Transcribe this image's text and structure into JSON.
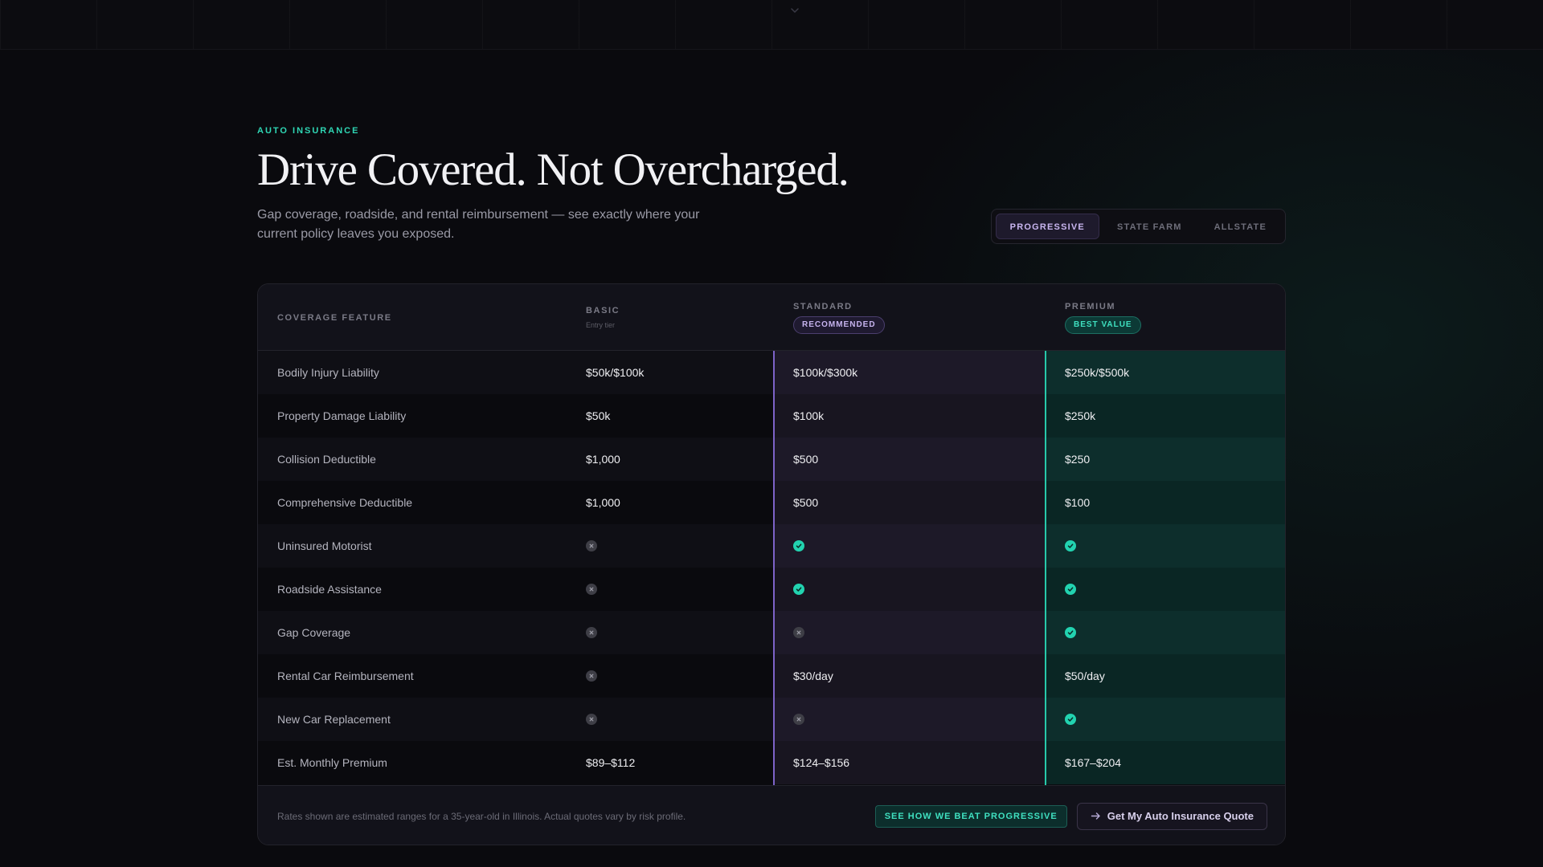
{
  "hero": {
    "eyebrow": "AUTO INSURANCE",
    "title": "Drive Covered. Not Overcharged.",
    "subtitle": "Gap coverage, roadside, and rental reimbursement — see exactly where your current policy leaves you exposed."
  },
  "carriers": {
    "tabs": [
      "PROGRESSIVE",
      "STATE FARM",
      "ALLSTATE"
    ],
    "active": "PROGRESSIVE"
  },
  "table": {
    "header": {
      "feature": "COVERAGE FEATURE",
      "basic": "BASIC",
      "basic_sub": "Entry tier",
      "standard": "STANDARD",
      "standard_badge": "RECOMMENDED",
      "premium": "PREMIUM",
      "premium_badge": "BEST VALUE"
    },
    "rows": [
      {
        "feature": "Bodily Injury Liability",
        "basic": "$50k/$100k",
        "standard": "$100k/$300k",
        "premium": "$250k/$500k"
      },
      {
        "feature": "Property Damage Liability",
        "basic": "$50k",
        "standard": "$100k",
        "premium": "$250k"
      },
      {
        "feature": "Collision Deductible",
        "basic": "$1,000",
        "standard": "$500",
        "premium": "$250"
      },
      {
        "feature": "Comprehensive Deductible",
        "basic": "$1,000",
        "standard": "$500",
        "premium": "$100"
      },
      {
        "feature": "Uninsured Motorist",
        "basic": "no",
        "standard": "yes",
        "premium": "yes"
      },
      {
        "feature": "Roadside Assistance",
        "basic": "no",
        "standard": "yes",
        "premium": "yes"
      },
      {
        "feature": "Gap Coverage",
        "basic": "no",
        "standard": "no",
        "premium": "yes"
      },
      {
        "feature": "Rental Car Reimbursement",
        "basic": "no",
        "standard": "$30/day",
        "premium": "$50/day"
      },
      {
        "feature": "New Car Replacement",
        "basic": "no",
        "standard": "no",
        "premium": "yes"
      },
      {
        "feature": "Est. Monthly Premium",
        "basic": "$89–$112",
        "standard": "$124–$156",
        "premium": "$167–$204"
      }
    ],
    "footer": {
      "disclaimer": "Rates shown are estimated ranges for a 35-year-old in Illinois. Actual quotes vary by risk profile.",
      "beat_label": "SEE HOW WE BEAT PROGRESSIVE",
      "quote_label": "Get My Auto Insurance Quote"
    }
  },
  "colors": {
    "accent_teal": "#2fd6b4",
    "accent_purple": "#7d63c8",
    "background": "#0a0a0e"
  },
  "icons": {
    "included": "check-circle-icon",
    "excluded": "x-circle-icon",
    "scroll": "chevron-down-icon",
    "quote": "arrow-right-icon"
  }
}
